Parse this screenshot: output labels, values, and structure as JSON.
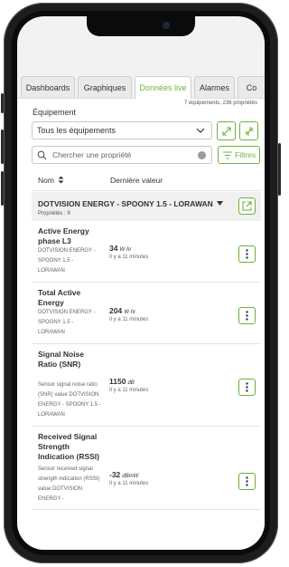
{
  "tabs": [
    "Dashboards",
    "Graphiques",
    "Données live",
    "Alarmes",
    "Co"
  ],
  "active_tab": "Données live",
  "summary": "7 équipements, 236 propriétés",
  "equipment": {
    "label": "Équipement",
    "selected": "Tous les équipements"
  },
  "search": {
    "placeholder": "Chercher une propriété"
  },
  "filter_label": "Filtres",
  "columns": {
    "name": "Nom",
    "last_value": "Dernière valeur"
  },
  "group": {
    "name": "DOTVISION ENERGY - SPOONY 1.5 - LORAWAN",
    "properties": "Propriétés : 9"
  },
  "rows": [
    {
      "name": "Active Energy phase L3",
      "desc": "DOTVISION ENERGY - SPOONY 1.5 - LORAWAN",
      "value": "34",
      "unit": "W·hr",
      "ago": "Il y a 11 minutes"
    },
    {
      "name": "Total Active Energy",
      "desc": "DOTVISION ENERGY - SPOONY 1.5 - LORAWAN",
      "value": "204",
      "unit": "W·hr",
      "ago": "Il y a 11 minutes"
    },
    {
      "name": "Signal Noise Ratio (SNR)",
      "desc": "Sensor signal noise ratio (SNR) value DOTVISION ENERGY - SPOONY 1.5 - LORAWAN",
      "value": "1150",
      "unit": "dB",
      "ago": "Il y a 11 minutes"
    },
    {
      "name": "Received Signal Strength Indication (RSSI)",
      "desc": "Sensor received signal strength indication (RSSI) value DOTVISION ENERGY -",
      "value": "-32",
      "unit": "dBmW",
      "ago": "Il y a 11 minutes"
    }
  ],
  "colors": {
    "accent": "#6bb33c",
    "frame": "#1d1d1f",
    "group_bg": "#f0f0f0"
  },
  "icons": [
    "chevron-down-icon",
    "expand-icon",
    "collapse-icon",
    "search-icon",
    "clear-icon",
    "filter-icon",
    "sort-icon",
    "external-link-icon",
    "kebab-menu-icon"
  ]
}
